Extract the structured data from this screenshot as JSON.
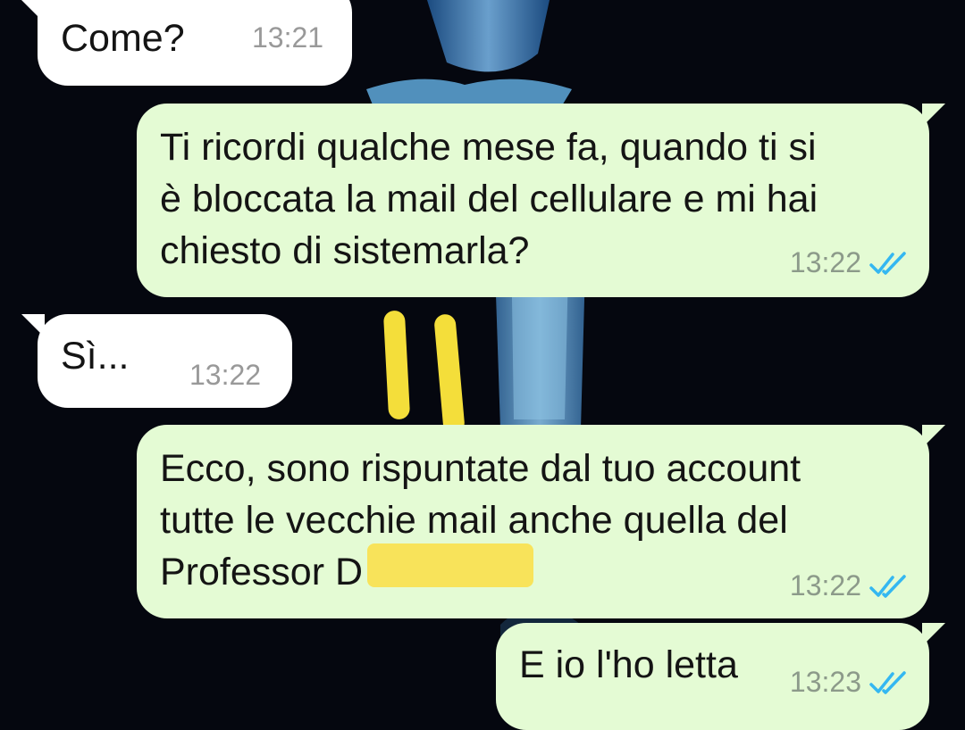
{
  "messages": [
    {
      "id": "m1",
      "direction": "incoming",
      "lines": [
        "Come?"
      ],
      "time": "13:21"
    },
    {
      "id": "m2",
      "direction": "outgoing",
      "lines": [
        "Ti ricordi qualche mese fa, quando ti si",
        "è bloccata la mail del cellulare e mi hai",
        "chiesto di sistemarla?"
      ],
      "time": "13:22",
      "status": "read"
    },
    {
      "id": "m3",
      "direction": "incoming",
      "lines": [
        "Sì..."
      ],
      "time": "13:22"
    },
    {
      "id": "m4",
      "direction": "outgoing",
      "lines": [
        "Ecco, sono rispuntate dal tuo account",
        "tutte le vecchie mail anche quella del",
        "Professor D"
      ],
      "time": "13:22",
      "status": "read"
    },
    {
      "id": "m5",
      "direction": "outgoing",
      "lines": [
        "E io l'ho letta"
      ],
      "time": "13:23",
      "status": "read"
    }
  ],
  "colors": {
    "incoming_bubble": "#ffffff",
    "outgoing_bubble": "#e4fbd4",
    "read_ticks": "#34b7f1",
    "highlight": "#f4de3a",
    "background": "#05070f"
  },
  "icons": {
    "read_receipt": "double-check-icon"
  }
}
